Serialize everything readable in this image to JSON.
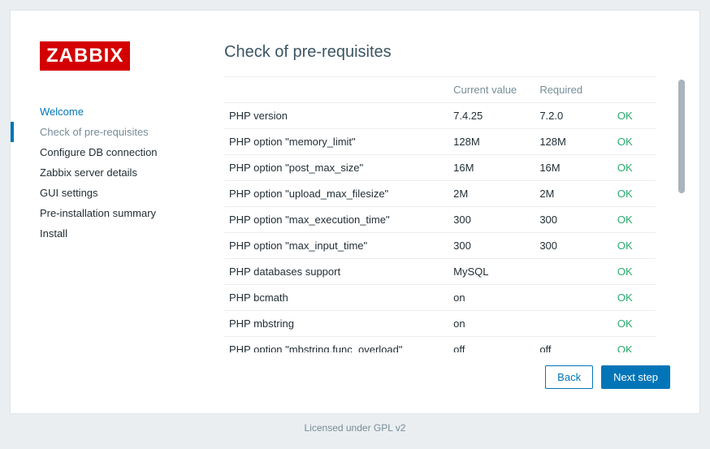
{
  "logo_text": "ZABBIX",
  "steps": [
    {
      "label": "Welcome",
      "state": "visited"
    },
    {
      "label": "Check of pre-requisites",
      "state": "current"
    },
    {
      "label": "Configure DB connection",
      "state": ""
    },
    {
      "label": "Zabbix server details",
      "state": ""
    },
    {
      "label": "GUI settings",
      "state": ""
    },
    {
      "label": "Pre-installation summary",
      "state": ""
    },
    {
      "label": "Install",
      "state": ""
    }
  ],
  "title": "Check of pre-requisites",
  "columns": {
    "name": "",
    "current": "Current value",
    "required": "Required",
    "status": ""
  },
  "rows": [
    {
      "name": "PHP version",
      "current": "7.4.25",
      "required": "7.2.0",
      "status": "OK"
    },
    {
      "name": "PHP option \"memory_limit\"",
      "current": "128M",
      "required": "128M",
      "status": "OK"
    },
    {
      "name": "PHP option \"post_max_size\"",
      "current": "16M",
      "required": "16M",
      "status": "OK"
    },
    {
      "name": "PHP option \"upload_max_filesize\"",
      "current": "2M",
      "required": "2M",
      "status": "OK"
    },
    {
      "name": "PHP option \"max_execution_time\"",
      "current": "300",
      "required": "300",
      "status": "OK"
    },
    {
      "name": "PHP option \"max_input_time\"",
      "current": "300",
      "required": "300",
      "status": "OK"
    },
    {
      "name": "PHP databases support",
      "current": "MySQL",
      "required": "",
      "status": "OK"
    },
    {
      "name": "PHP bcmath",
      "current": "on",
      "required": "",
      "status": "OK"
    },
    {
      "name": "PHP mbstring",
      "current": "on",
      "required": "",
      "status": "OK"
    },
    {
      "name": "PHP option \"mbstring.func_overload\"",
      "current": "off",
      "required": "off",
      "status": "OK"
    }
  ],
  "buttons": {
    "back": "Back",
    "next": "Next step"
  },
  "footer": {
    "text": "Licensed under ",
    "link": "GPL v2"
  },
  "colors": {
    "brand_red": "#d40000",
    "primary": "#0275b8",
    "ok": "#2aab6f"
  }
}
